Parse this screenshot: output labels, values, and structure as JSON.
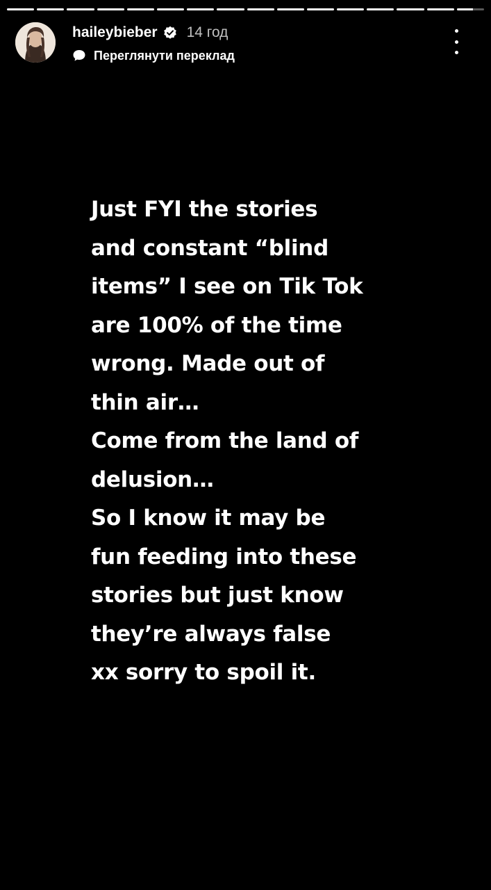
{
  "story": {
    "progress": {
      "segment_count": 16,
      "completed_segments": 15,
      "current_segment_fraction": 0.6
    },
    "header": {
      "username": "haileybieber",
      "verified_icon": "verified-badge-icon",
      "time_ago": "14 год",
      "translate_label": "Переглянути переклад",
      "translate_icon": "speech-bubble-icon",
      "more_icon": "more-vertical-icon"
    },
    "text_lines": [
      "Just FYI the stories",
      "and constant “blind",
      "items” I see on Tik Tok",
      "are 100% of the time",
      "wrong. Made out of",
      "thin air…",
      "Come from the land of",
      "delusion…",
      "So I know it may be",
      "fun feeding into these",
      "stories but just know",
      "they’re always false",
      "xx sorry to spoil it."
    ]
  }
}
